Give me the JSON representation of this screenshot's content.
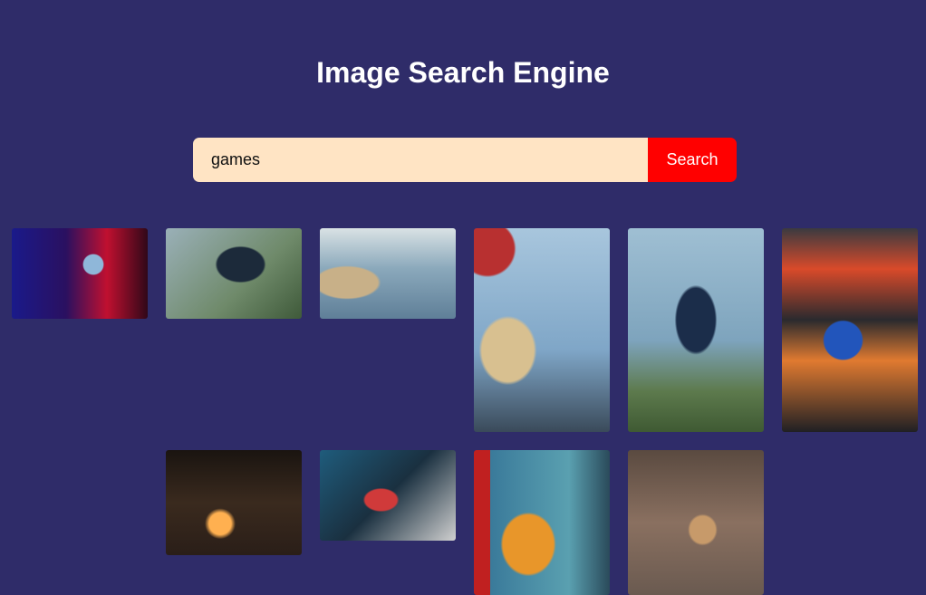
{
  "header": {
    "title": "Image Search Engine"
  },
  "search": {
    "value": "games",
    "button_label": "Search"
  },
  "results": {
    "count": 10
  },
  "colors": {
    "background": "#2f2c69",
    "input_bg": "#ffe4c4",
    "button_bg": "#ff0000"
  }
}
